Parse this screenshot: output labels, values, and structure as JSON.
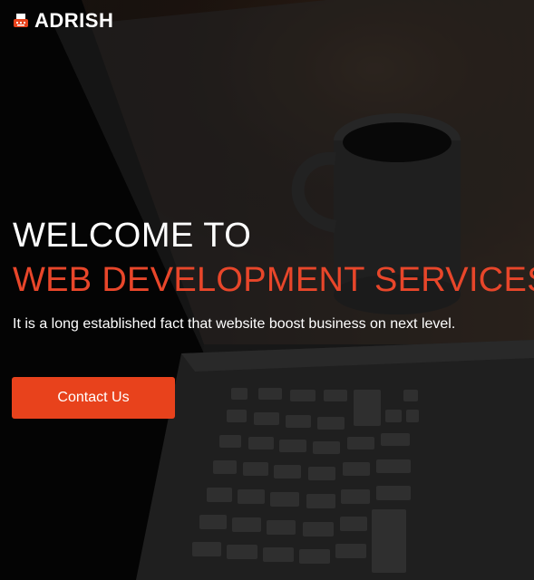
{
  "brand": {
    "name": "ADRISH",
    "icon": "typewriter-icon"
  },
  "hero": {
    "heading_line1": "WELCOME TO",
    "heading_line2": "WEB DEVELOPMENT SERVICES",
    "lead": "It is a long established fact that website boost business on next level.",
    "cta_label": "Contact Us"
  },
  "colors": {
    "accent": "#e8421c",
    "heading_accent": "#e8462a",
    "text": "#ffffff"
  }
}
